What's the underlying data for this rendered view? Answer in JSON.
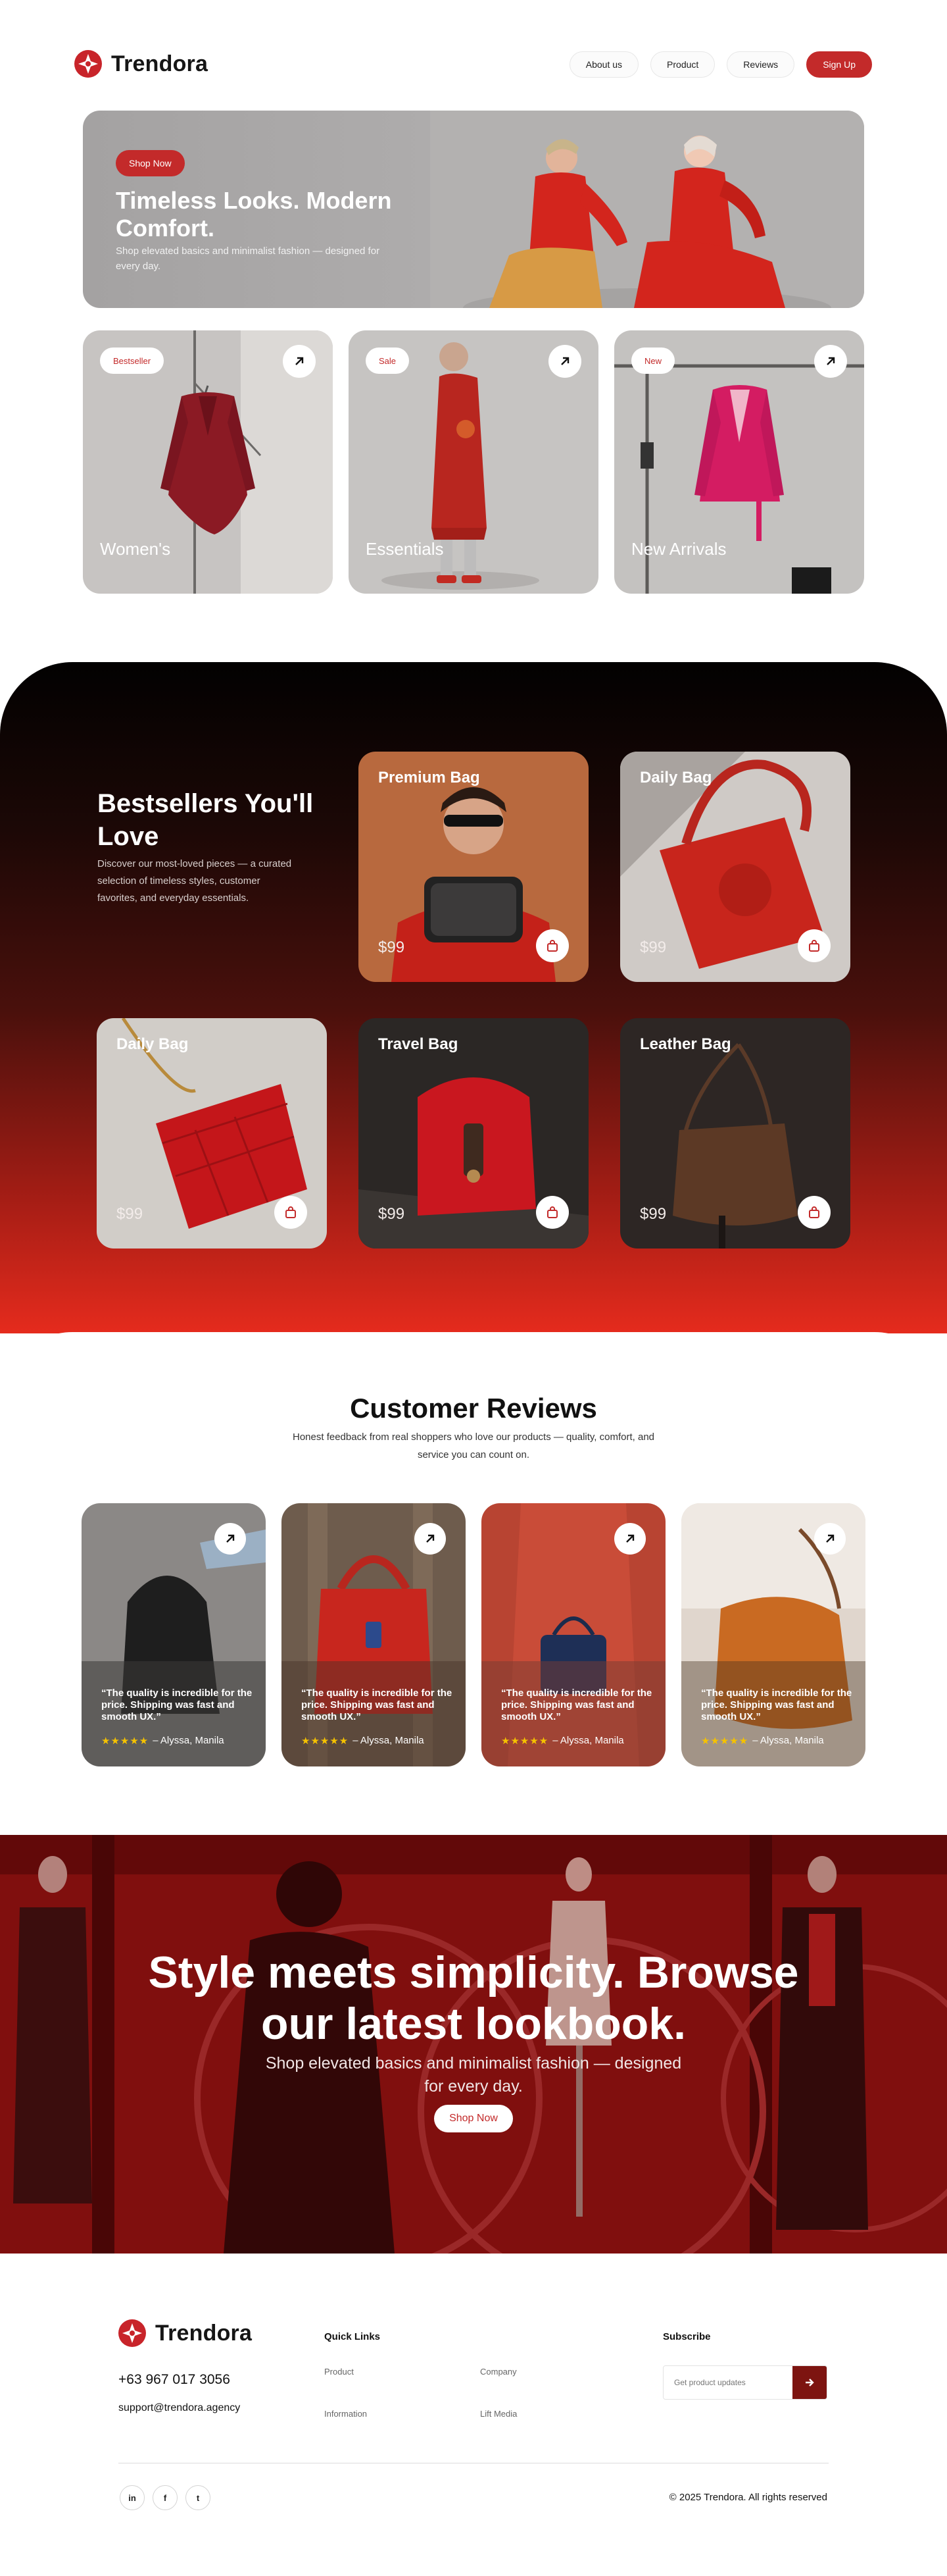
{
  "brand": {
    "name": "Trendora",
    "accent": "#c32a2a"
  },
  "nav": {
    "about": "About us",
    "product": "Product",
    "reviews": "Reviews",
    "signup": "Sign Up"
  },
  "hero": {
    "cta": "Shop Now",
    "title": "Timeless Looks. Modern Comfort.",
    "subtitle": "Shop elevated basics and minimalist fashion — designed for every day."
  },
  "categories": [
    {
      "badge": "Bestseller",
      "title": "Women's",
      "icon": "arrow-up-right-icon"
    },
    {
      "badge": "Sale",
      "title": "Essentials",
      "icon": "arrow-up-right-icon"
    },
    {
      "badge": "New",
      "title": "New Arrivals",
      "icon": "arrow-up-right-icon"
    }
  ],
  "bestsellers": {
    "title": "Bestsellers You'll Love",
    "description": "Discover our most-loved pieces — a curated selection of timeless styles, customer favorites, and everyday essentials.",
    "products": [
      {
        "name": "Premium Bag",
        "price": "$99"
      },
      {
        "name": "Daily Bag",
        "price": "$99"
      },
      {
        "name": "Daily Bag",
        "price": "$99"
      },
      {
        "name": "Travel Bag",
        "price": "$99"
      },
      {
        "name": "Leather Bag",
        "price": "$99"
      }
    ]
  },
  "reviews": {
    "title": "Customer Reviews",
    "subtitle": "Honest feedback from real shoppers who love our products — quality, comfort, and service you can count on.",
    "items": [
      {
        "quote": "“The quality is incredible for the price. Shipping was fast and smooth UX.”",
        "stars": "★★★★★",
        "author": "– Alyssa, Manila"
      },
      {
        "quote": "“The quality is incredible for the price. Shipping was fast and smooth UX.”",
        "stars": "★★★★★",
        "author": "– Alyssa, Manila"
      },
      {
        "quote": "“The quality is incredible for the price. Shipping was fast and smooth UX.”",
        "stars": "★★★★★",
        "author": "– Alyssa, Manila"
      },
      {
        "quote": "“The quality is incredible for the price. Shipping was fast and smooth UX.”",
        "stars": "★★★★★",
        "author": "– Alyssa, Manila"
      }
    ]
  },
  "banner": {
    "title": "Style meets simplicity. Browse our latest lookbook.",
    "subtitle": "Shop elevated basics and minimalist fashion — designed for every day.",
    "cta": "Shop Now"
  },
  "footer": {
    "phone": "+63 967 017 3056",
    "email": "support@trendora.agency",
    "quick_links_title": "Quick Links",
    "links": {
      "product": "Product",
      "company": "Company",
      "information": "Information",
      "lift_media": "Lift Media"
    },
    "subscribe_title": "Subscribe",
    "subscribe_placeholder": "Get product updates",
    "social": {
      "linkedin": "in",
      "facebook": "f",
      "twitter": "t"
    },
    "copyright": "© 2025 Trendora. All rights reserved"
  }
}
